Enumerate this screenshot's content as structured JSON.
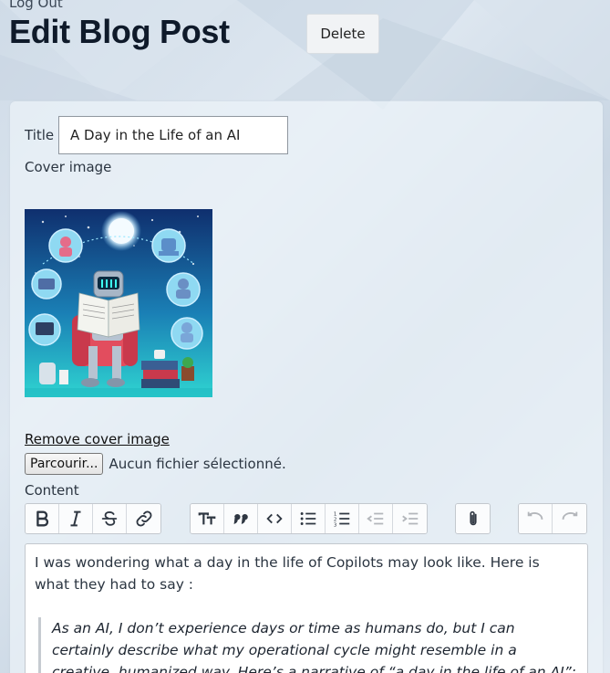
{
  "header": {
    "logout_label": "Log Out",
    "page_title": "Edit Blog Post",
    "delete_label": "Delete"
  },
  "form": {
    "title_label": "Title",
    "title_value": "A Day in the Life of an AI",
    "cover_label": "Cover image",
    "cover_image_alt": "Robot reading a newspaper in an armchair surrounded by thought bubbles",
    "remove_cover_label": "Remove cover image",
    "file_button_label": "Parcourir...",
    "file_status": "Aucun fichier sélectionné.",
    "content_label": "Content"
  },
  "toolbar": {
    "groups": [
      [
        "bold-icon",
        "italic-icon",
        "strikethrough-icon",
        "link-icon"
      ],
      [
        "heading-icon",
        "quote-icon",
        "code-icon",
        "bullet-list-icon",
        "numbered-list-icon",
        "decrease-indent-icon",
        "increase-indent-icon"
      ],
      [
        "attach-icon"
      ],
      [
        "undo-icon",
        "redo-icon"
      ]
    ]
  },
  "editor": {
    "paragraph": "I was wondering what a day in the life of Copilots may look like. Here is what they had to say :",
    "quote": "As an AI, I don’t experience days or time as humans do, but I can certainly describe what my operational cycle might resemble in a creative, humanized way. Here’s a narrative of “a day in the life of an AI”:"
  },
  "colors": {
    "page_bg": "#d5e0eb",
    "card_bg": "#ecf2f8",
    "title_text": "#0f1a2a",
    "delete_bg": "#f1f3f5"
  }
}
